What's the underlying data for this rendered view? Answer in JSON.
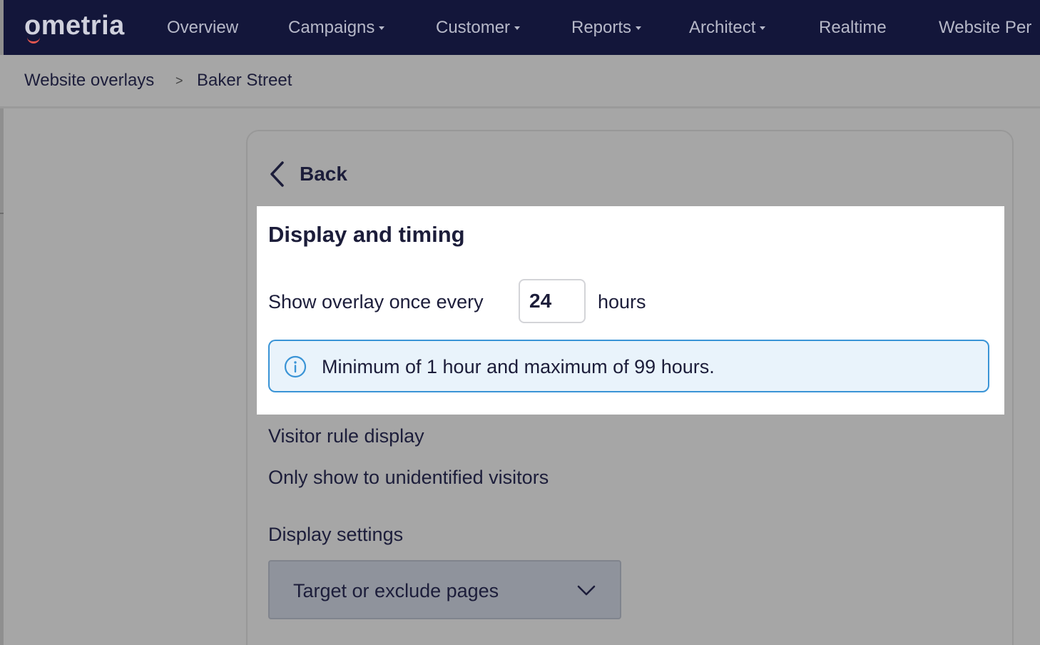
{
  "app": {
    "logo_text": "ometria",
    "nav": [
      {
        "label": "Overview",
        "dropdown": false
      },
      {
        "label": "Campaigns",
        "dropdown": true
      },
      {
        "label": "Customer",
        "dropdown": true
      },
      {
        "label": "Reports",
        "dropdown": true
      },
      {
        "label": "Architect",
        "dropdown": true
      },
      {
        "label": "Realtime",
        "dropdown": false
      },
      {
        "label": "Website Per",
        "dropdown": false
      }
    ]
  },
  "breadcrumb": {
    "items": [
      "Website overlays",
      "Baker Street"
    ],
    "separator": ">"
  },
  "back": {
    "label": "Back",
    "icon": "chevron-left-icon"
  },
  "display_timing": {
    "title": "Display and timing",
    "frequency_label": "Show overlay once every",
    "frequency_value": "24",
    "frequency_unit": "hours",
    "info_icon": "info-icon",
    "info_text": "Minimum of 1 hour and maximum of 99 hours."
  },
  "visitor_rule": {
    "title": "Visitor rule display",
    "value": "Only show to unidentified visitors"
  },
  "display_settings": {
    "title": "Display settings",
    "select_label": "Target or exclude pages",
    "select_icon": "chevron-down-icon"
  },
  "colors": {
    "nav_bg": "#13163a",
    "overlay_grey": "#a6a6a6",
    "text_dark": "#1c1d3a",
    "info_border": "#3a94d6",
    "info_bg": "#e9f3fb",
    "brand_accent": "#e2564f"
  }
}
